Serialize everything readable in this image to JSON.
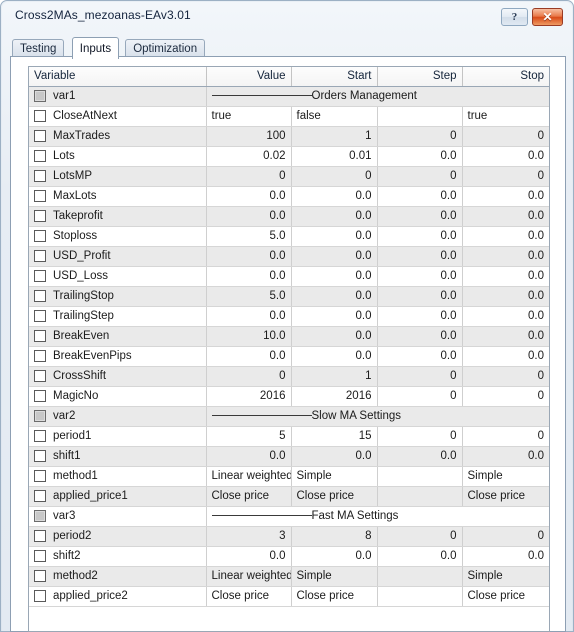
{
  "window": {
    "title": "Cross2MAs_mezoanas-EAv3.01",
    "help_label": "?",
    "close_label": "✕"
  },
  "tabs": [
    {
      "label": "Testing",
      "active": false
    },
    {
      "label": "Inputs",
      "active": true
    },
    {
      "label": "Optimization",
      "active": false
    }
  ],
  "grid": {
    "headers": [
      "Variable",
      "Value",
      "Start",
      "Step",
      "Stop"
    ],
    "rows": [
      {
        "type": "separator",
        "variable": "var1",
        "checked": false,
        "disabled": true,
        "label": "Orders Management"
      },
      {
        "type": "data",
        "variable": "CloseAtNext",
        "checked": false,
        "align": "text",
        "value": "true",
        "start": "false",
        "step": "",
        "stop": "true"
      },
      {
        "type": "data",
        "variable": "MaxTrades",
        "checked": false,
        "align": "num",
        "value": "100",
        "start": "1",
        "step": "0",
        "stop": "0"
      },
      {
        "type": "data",
        "variable": "Lots",
        "checked": false,
        "align": "num",
        "value": "0.02",
        "start": "0.01",
        "step": "0.0",
        "stop": "0.0"
      },
      {
        "type": "data",
        "variable": "LotsMP",
        "checked": false,
        "align": "num",
        "value": "0",
        "start": "0",
        "step": "0",
        "stop": "0"
      },
      {
        "type": "data",
        "variable": "MaxLots",
        "checked": false,
        "align": "num",
        "value": "0.0",
        "start": "0.0",
        "step": "0.0",
        "stop": "0.0"
      },
      {
        "type": "data",
        "variable": "Takeprofit",
        "checked": false,
        "align": "num",
        "value": "0.0",
        "start": "0.0",
        "step": "0.0",
        "stop": "0.0"
      },
      {
        "type": "data",
        "variable": "Stoploss",
        "checked": false,
        "align": "num",
        "value": "5.0",
        "start": "0.0",
        "step": "0.0",
        "stop": "0.0"
      },
      {
        "type": "data",
        "variable": "USD_Profit",
        "checked": false,
        "align": "num",
        "value": "0.0",
        "start": "0.0",
        "step": "0.0",
        "stop": "0.0"
      },
      {
        "type": "data",
        "variable": "USD_Loss",
        "checked": false,
        "align": "num",
        "value": "0.0",
        "start": "0.0",
        "step": "0.0",
        "stop": "0.0"
      },
      {
        "type": "data",
        "variable": "TrailingStop",
        "checked": false,
        "align": "num",
        "value": "5.0",
        "start": "0.0",
        "step": "0.0",
        "stop": "0.0"
      },
      {
        "type": "data",
        "variable": "TrailingStep",
        "checked": false,
        "align": "num",
        "value": "0.0",
        "start": "0.0",
        "step": "0.0",
        "stop": "0.0"
      },
      {
        "type": "data",
        "variable": "BreakEven",
        "checked": false,
        "align": "num",
        "value": "10.0",
        "start": "0.0",
        "step": "0.0",
        "stop": "0.0"
      },
      {
        "type": "data",
        "variable": "BreakEvenPips",
        "checked": false,
        "align": "num",
        "value": "0.0",
        "start": "0.0",
        "step": "0.0",
        "stop": "0.0"
      },
      {
        "type": "data",
        "variable": "CrossShift",
        "checked": false,
        "align": "num",
        "value": "0",
        "start": "1",
        "step": "0",
        "stop": "0"
      },
      {
        "type": "data",
        "variable": "MagicNo",
        "checked": false,
        "align": "num",
        "value": "2016",
        "start": "2016",
        "step": "0",
        "stop": "0"
      },
      {
        "type": "separator",
        "variable": "var2",
        "checked": false,
        "disabled": true,
        "label": "Slow MA Settings"
      },
      {
        "type": "data",
        "variable": "period1",
        "checked": false,
        "align": "num",
        "value": "5",
        "start": "15",
        "step": "0",
        "stop": "0"
      },
      {
        "type": "data",
        "variable": "shift1",
        "checked": false,
        "align": "num",
        "value": "0.0",
        "start": "0.0",
        "step": "0.0",
        "stop": "0.0"
      },
      {
        "type": "data",
        "variable": "method1",
        "checked": false,
        "align": "text",
        "value": "Linear weighted",
        "start": "Simple",
        "step": "",
        "stop": "Simple"
      },
      {
        "type": "data",
        "variable": "applied_price1",
        "checked": false,
        "align": "text",
        "value": "Close price",
        "start": "Close price",
        "step": "",
        "stop": "Close price"
      },
      {
        "type": "separator",
        "variable": "var3",
        "checked": false,
        "disabled": true,
        "label": "Fast MA Settings"
      },
      {
        "type": "data",
        "variable": "period2",
        "checked": false,
        "align": "num",
        "value": "3",
        "start": "8",
        "step": "0",
        "stop": "0"
      },
      {
        "type": "data",
        "variable": "shift2",
        "checked": false,
        "align": "num",
        "value": "0.0",
        "start": "0.0",
        "step": "0.0",
        "stop": "0.0"
      },
      {
        "type": "data",
        "variable": "method2",
        "checked": false,
        "align": "text",
        "value": "Linear weighted",
        "start": "Simple",
        "step": "",
        "stop": "Simple"
      },
      {
        "type": "data",
        "variable": "applied_price2",
        "checked": false,
        "align": "text",
        "value": "Close price",
        "start": "Close price",
        "step": "",
        "stop": "Close price"
      }
    ]
  }
}
